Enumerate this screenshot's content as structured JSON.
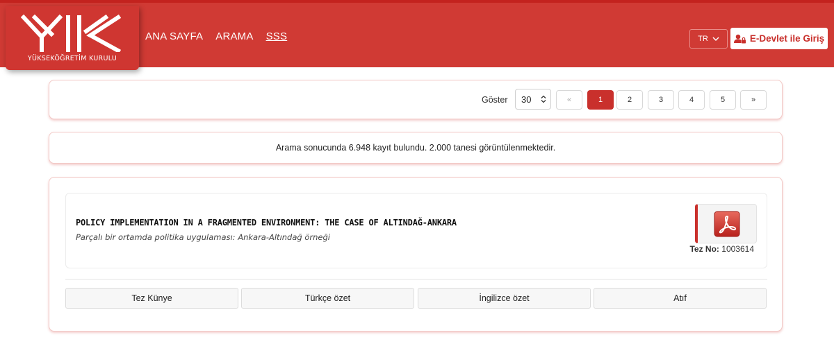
{
  "header": {
    "logo_text": "YÜKSEKÖĞRETİM KURULU",
    "nav": [
      "ANA SAYFA",
      "ARAMA",
      "SSS"
    ],
    "lang": "TR",
    "edevlet_label": "E-Devlet ile Giriş",
    "brand_color": "#d03a34"
  },
  "pager": {
    "show_label": "Göster",
    "page_size": "30",
    "prev": "«",
    "pages": [
      "1",
      "2",
      "3",
      "4",
      "5"
    ],
    "next": "»",
    "active_page": "1"
  },
  "info": {
    "text": "Arama sonucunda 6.948 kayıt bulundu. 2.000 tanesi görüntülenmektedir."
  },
  "result": {
    "title": "POLICY IMPLEMENTATION IN A FRAGMENTED ENVIRONMENT: THE CASE OF ALTINDAĞ-ANKARA",
    "subtitle": "Parçalı bir ortamda politika uygulaması: Ankara-Altındağ örneği",
    "tez_no_label": "Tez No:",
    "tez_no": "1003614",
    "tabs": [
      "Tez Künye",
      "Türkçe özet",
      "İngilizce özet",
      "Atıf"
    ]
  }
}
